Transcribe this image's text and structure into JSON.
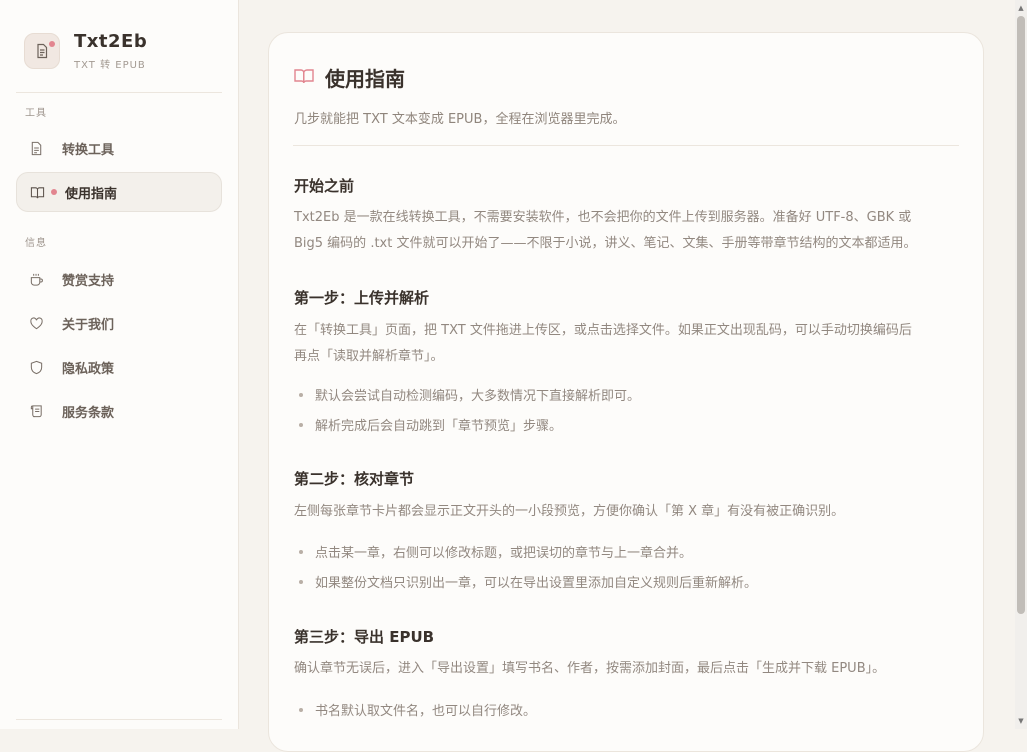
{
  "brand": {
    "name": "Txt2Eb",
    "subtitle": "TXT 转 EPUB",
    "logo_icon": "document-icon"
  },
  "sidebar": {
    "section_tools": "工具",
    "section_info": "信息",
    "items": [
      {
        "label": "转换工具",
        "icon": "document-icon",
        "active": false
      },
      {
        "label": "使用指南",
        "icon": "book-open-icon",
        "active": true
      },
      {
        "label": "赞赏支持",
        "icon": "coffee-cup-icon",
        "active": false
      },
      {
        "label": "关于我们",
        "icon": "heart-icon",
        "active": false
      },
      {
        "label": "隐私政策",
        "icon": "shield-icon",
        "active": false
      },
      {
        "label": "服务条款",
        "icon": "scroll-icon",
        "active": false
      }
    ]
  },
  "page": {
    "title": "使用指南",
    "intro": "几步就能把 TXT 文本变成 EPUB，全程在浏览器里完成。",
    "sections": [
      {
        "heading": "开始之前",
        "paragraph_lines": [
          "Txt2Eb 是一款在线转换工具，不需要安装软件，也不会把你的文件上传到服务器。准备好 UTF-8、GBK 或",
          "Big5 编码的 .txt 文件就可以开始了——不限于小说，讲义、笔记、文集、手册等带章节结构的文本都适用。"
        ],
        "bullets": []
      },
      {
        "heading": "第一步：上传并解析",
        "paragraph_lines": [
          "在「转换工具」页面，把 TXT 文件拖进上传区，或点击选择文件。如果正文出现乱码，可以手动切换编码后",
          "再点「读取并解析章节」。"
        ],
        "bullets": [
          "默认会尝试自动检测编码，大多数情况下直接解析即可。",
          "解析完成后会自动跳到「章节预览」步骤。"
        ]
      },
      {
        "heading": "第二步：核对章节",
        "paragraph_lines": [
          "左侧每张章节卡片都会显示正文开头的一小段预览，方便你确认「第 X 章」有没有被正确识别。"
        ],
        "bullets": [
          "点击某一章，右侧可以修改标题，或把误切的章节与上一章合并。",
          "如果整份文档只识别出一章，可以在导出设置里添加自定义规则后重新解析。"
        ]
      },
      {
        "heading": "第三步：导出 EPUB",
        "paragraph_lines": [
          "确认章节无误后，进入「导出设置」填写书名、作者，按需添加封面，最后点击「生成并下载 EPUB」。"
        ],
        "bullets": [
          "书名默认取文件名，也可以自行修改。"
        ]
      }
    ]
  },
  "colors": {
    "accent": "#e2858f",
    "background": "#f6f3ee",
    "card": "#fdfcfa"
  }
}
